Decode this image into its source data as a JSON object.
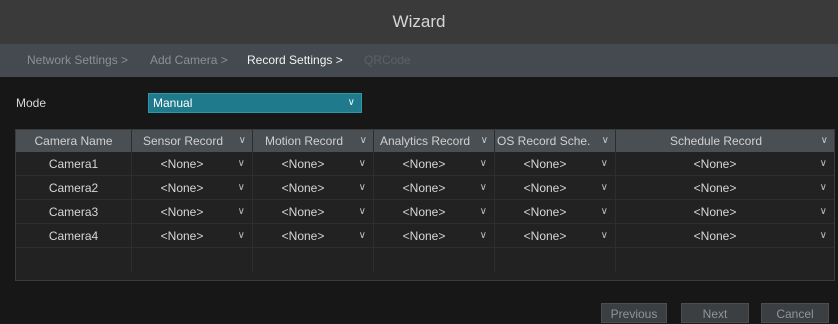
{
  "window": {
    "title": "Wizard"
  },
  "steps": [
    {
      "label": "Network Settings >",
      "state": "done"
    },
    {
      "label": "Add Camera >",
      "state": "done"
    },
    {
      "label": "Record Settings >",
      "state": "active"
    },
    {
      "label": "QRCode",
      "state": "pending"
    }
  ],
  "mode": {
    "label": "Mode",
    "value": "Manual"
  },
  "table": {
    "columns": [
      "Camera Name",
      "Sensor Record",
      "Motion Record",
      "Analytics Record",
      "OS Record Sche.",
      "Schedule Record"
    ],
    "rows": [
      {
        "camera": "Camera1",
        "values": [
          "<None>",
          "<None>",
          "<None>",
          "<None>",
          "<None>"
        ]
      },
      {
        "camera": "Camera2",
        "values": [
          "<None>",
          "<None>",
          "<None>",
          "<None>",
          "<None>"
        ]
      },
      {
        "camera": "Camera3",
        "values": [
          "<None>",
          "<None>",
          "<None>",
          "<None>",
          "<None>"
        ]
      },
      {
        "camera": "Camera4",
        "values": [
          "<None>",
          "<None>",
          "<None>",
          "<None>",
          "<None>"
        ]
      }
    ]
  },
  "buttons": {
    "previous": "Previous",
    "next": "Next",
    "cancel": "Cancel"
  },
  "colors": {
    "accent": "#1f7a8c",
    "header_bg": "#4a4f54",
    "title_bg": "#3a3a3a"
  },
  "icons": {
    "dropdown": "chevron-down-icon"
  }
}
